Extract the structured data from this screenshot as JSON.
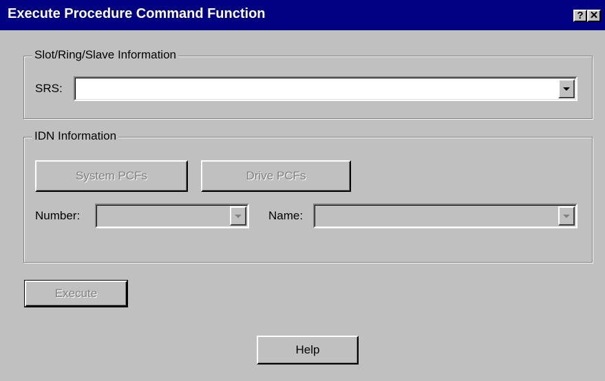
{
  "window": {
    "title": "Execute Procedure Command Function",
    "help_glyph": "?",
    "close_glyph": "✕"
  },
  "srs_group": {
    "legend": "Slot/Ring/Slave Information",
    "srs_label": "SRS:",
    "srs_value": ""
  },
  "idn_group": {
    "legend": "IDN Information",
    "system_pcfs_label": "System PCFs",
    "drive_pcfs_label": "Drive PCFs",
    "number_label": "Number:",
    "number_value": "",
    "name_label": "Name:",
    "name_value": ""
  },
  "buttons": {
    "execute_label": "Execute",
    "help_label": "Help"
  },
  "colors": {
    "titlebar": "#000080",
    "face": "#c0c0c0",
    "disabled_text": "#808080"
  }
}
